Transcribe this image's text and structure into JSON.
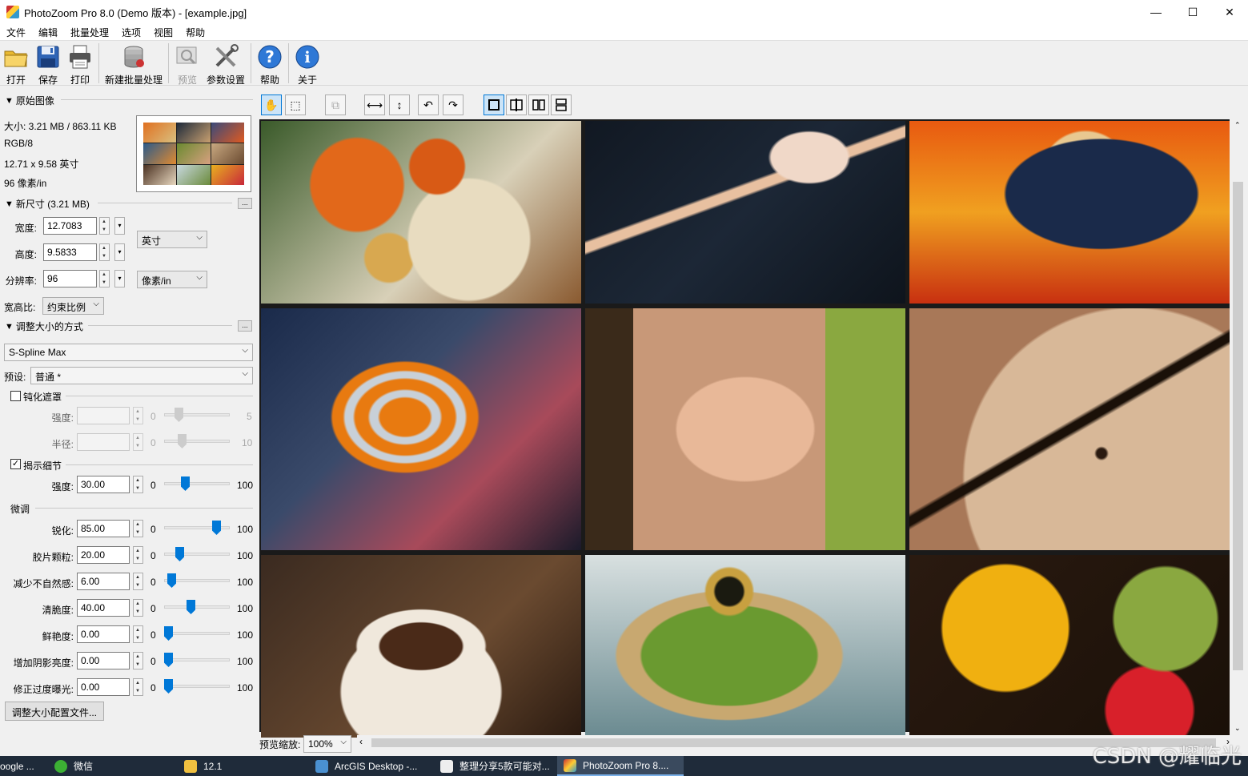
{
  "window": {
    "title": "PhotoZoom Pro 8.0 (Demo 版本) - [example.jpg]",
    "minimize": "—",
    "maximize": "☐",
    "close": "✕"
  },
  "menu": [
    "文件",
    "编辑",
    "批量处理",
    "选项",
    "视图",
    "帮助"
  ],
  "toolbar": {
    "open": "打开",
    "save": "保存",
    "print": "打印",
    "new_batch": "新建批量处理",
    "preview": "预览",
    "settings": "参数设置",
    "help": "帮助",
    "about": "关于"
  },
  "original": {
    "header": "原始图像",
    "size": "大小: 3.21 MB / 863.11 KB",
    "mode": "RGB/8",
    "dims": "12.71 x 9.58 英寸",
    "res": "96 像素/in"
  },
  "new_size": {
    "header": "新尺寸 (3.21 MB)",
    "width_label": "宽度:",
    "width": "12.7083",
    "height_label": "高度:",
    "height": "9.5833",
    "res_label": "分辨率:",
    "res": "96",
    "unit": "英寸",
    "res_unit": "像素/in",
    "aspect_label": "宽高比:",
    "aspect": "约束比例",
    "more": "..."
  },
  "resize": {
    "header": "调整大小的方式",
    "method": "S-Spline Max",
    "preset_label": "预设:",
    "preset": "普通 *",
    "unsharp_label": "钝化遮罩",
    "unsharp_checked": false,
    "strength_label": "强度:",
    "radius_label": "半径:",
    "unsharp_strength_min": "0",
    "unsharp_strength_max": "5",
    "unsharp_radius_min": "0",
    "unsharp_radius_max": "10",
    "detail_label": "揭示细节",
    "detail_checked": true,
    "detail_strength_label": "强度:",
    "detail_strength": "30.00",
    "detail_min": "0",
    "detail_max": "100",
    "detail_level": 0.3,
    "tune_header": "微调",
    "tune": [
      {
        "label": "锐化:",
        "value": "85.00",
        "min": "0",
        "max": "100",
        "level": 0.85
      },
      {
        "label": "胶片颗粒:",
        "value": "20.00",
        "min": "0",
        "max": "100",
        "level": 0.2
      },
      {
        "label": "减少不自然感:",
        "value": "6.00",
        "min": "0",
        "max": "100",
        "level": 0.06
      },
      {
        "label": "清脆度:",
        "value": "40.00",
        "min": "0",
        "max": "100",
        "level": 0.4
      },
      {
        "label": "鲜艳度:",
        "value": "0.00",
        "min": "0",
        "max": "100",
        "level": 0.0
      },
      {
        "label": "增加阴影亮度:",
        "value": "0.00",
        "min": "0",
        "max": "100",
        "level": 0.0
      },
      {
        "label": "修正过度曝光:",
        "value": "0.00",
        "min": "0",
        "max": "100",
        "level": 0.0
      }
    ],
    "profile_button": "调整大小配置文件..."
  },
  "viewtools": {
    "hand": "✋",
    "select": "⬚",
    "crop": "⧉",
    "fit_w": "⟷",
    "fit_h": "↕",
    "rot_l": "↶",
    "rot_r": "↷"
  },
  "zoom": {
    "label": "预览缩放:",
    "value": "100%"
  },
  "taskbar": [
    "oogle ...",
    "微信",
    "12.1",
    "ArcGIS Desktop -...",
    "整理分享5款可能对...",
    "PhotoZoom Pro 8...."
  ],
  "watermark": "CSDN @耀临光"
}
